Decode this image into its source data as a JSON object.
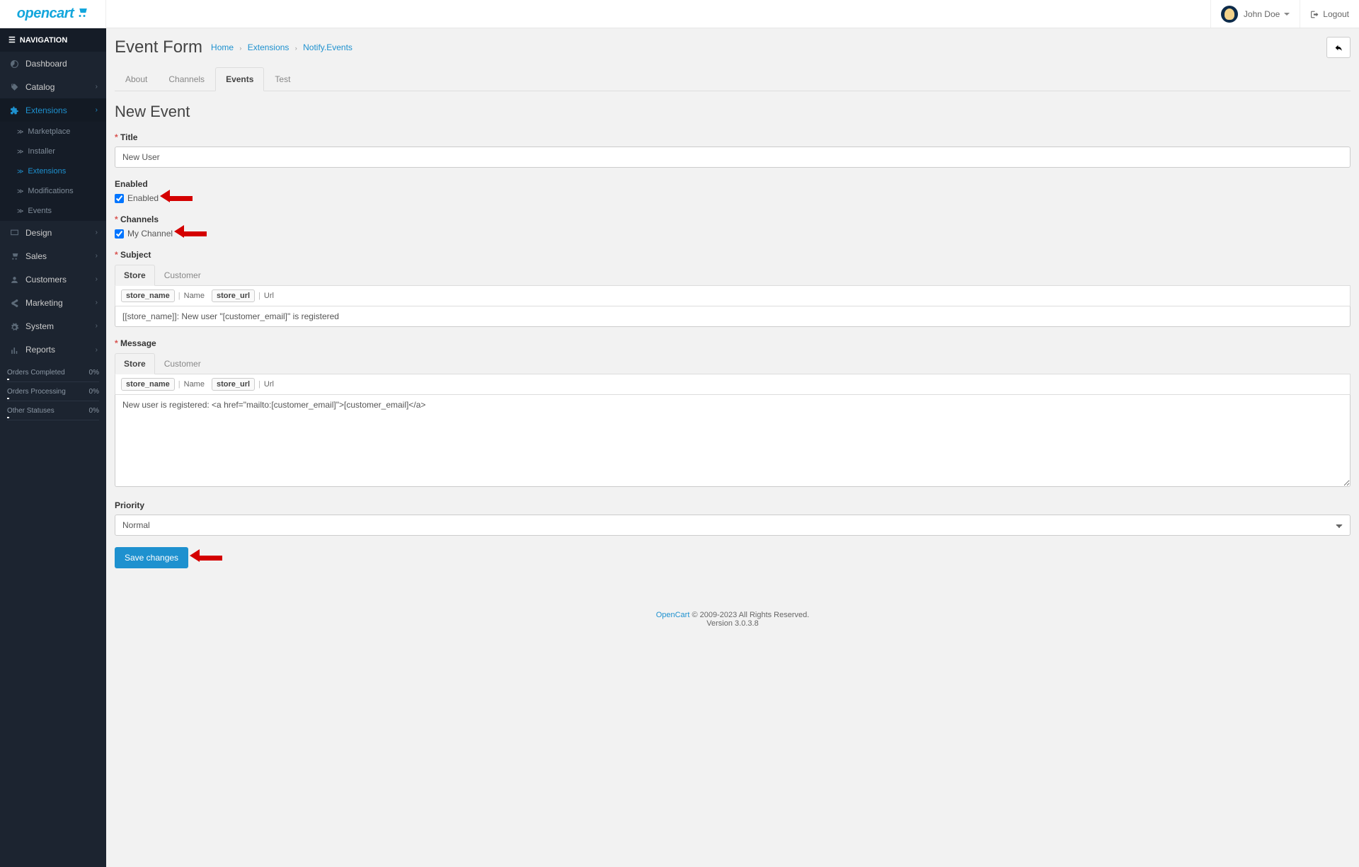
{
  "brand": {
    "name": "opencart"
  },
  "user": {
    "name": "John Doe",
    "logout": "Logout"
  },
  "nav": {
    "header": "NAVIGATION",
    "dashboard": "Dashboard",
    "catalog": "Catalog",
    "extensions": "Extensions",
    "marketplace": "Marketplace",
    "installer": "Installer",
    "sub_extensions": "Extensions",
    "modifications": "Modifications",
    "events": "Events",
    "design": "Design",
    "sales": "Sales",
    "customers": "Customers",
    "marketing": "Marketing",
    "system": "System",
    "reports": "Reports"
  },
  "stats": {
    "orders_completed": {
      "label": "Orders Completed",
      "value": "0%"
    },
    "orders_processing": {
      "label": "Orders Processing",
      "value": "0%"
    },
    "other_statuses": {
      "label": "Other Statuses",
      "value": "0%"
    }
  },
  "page": {
    "title": "Event Form",
    "breadcrumb": {
      "home": "Home",
      "extensions": "Extensions",
      "current": "Notify.Events"
    }
  },
  "tabs": {
    "about": "About",
    "channels": "Channels",
    "events": "Events",
    "test": "Test"
  },
  "form": {
    "heading": "New Event",
    "labels": {
      "title": "Title",
      "enabled": "Enabled",
      "channels": "Channels",
      "subject": "Subject",
      "message": "Message",
      "priority": "Priority"
    },
    "title_value": "New User",
    "enabled_text": "Enabled",
    "channel_name": "My Channel",
    "sub_tabs": {
      "store": "Store",
      "customer": "Customer"
    },
    "code_buttons": {
      "store_name": "store_name",
      "name": "Name",
      "store_url": "store_url",
      "url": "Url"
    },
    "subject_value": "[[store_name]]: New user \"[customer_email]\" is registered",
    "message_value": "New user is registered: <a href=\"mailto:[customer_email]\">[customer_email]</a>",
    "priority_value": "Normal",
    "save_button": "Save changes"
  },
  "footer": {
    "link": "OpenCart",
    "copyright": " © 2009-2023 All Rights Reserved.",
    "version": "Version 3.0.3.8"
  }
}
